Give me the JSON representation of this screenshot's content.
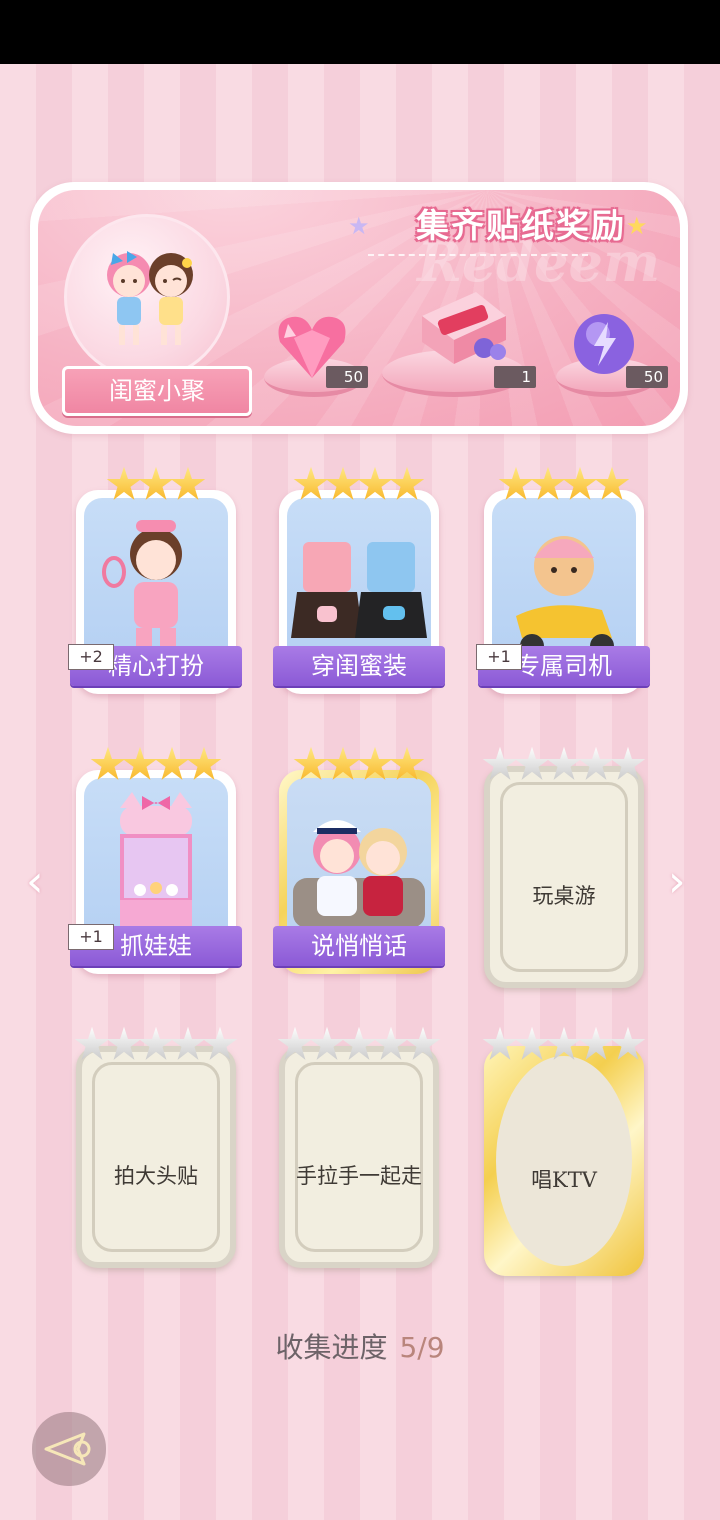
{
  "banner": {
    "title": "集齐贴纸奖励",
    "watermark": "Redeem",
    "friends_label": "闺蜜小聚",
    "rewards": [
      {
        "icon": "pink-heart-gem-icon",
        "count": "50"
      },
      {
        "icon": "gift-box-icon",
        "count": "1"
      },
      {
        "icon": "purple-lightning-orb-icon",
        "count": "50"
      }
    ]
  },
  "cards": [
    {
      "name": "精心打扮",
      "stars": 3,
      "tag": "+2",
      "unlocked": true
    },
    {
      "name": "穿闺蜜装",
      "stars": 4,
      "tag": "",
      "unlocked": true
    },
    {
      "name": "专属司机",
      "stars": 4,
      "tag": "+1",
      "unlocked": true
    },
    {
      "name": "抓娃娃",
      "stars": 4,
      "tag": "+1",
      "unlocked": true
    },
    {
      "name": "说悄悄话",
      "stars": 4,
      "tag": "",
      "unlocked": true
    },
    {
      "name": "玩桌游",
      "stars": 5,
      "unlocked": false
    },
    {
      "name": "拍大头贴",
      "stars": 5,
      "unlocked": false
    },
    {
      "name": "手拉手一起走",
      "stars": 5,
      "unlocked": false
    },
    {
      "name": "唱KTV",
      "stars": 5,
      "unlocked": false
    }
  ],
  "progress": {
    "label": "收集进度",
    "value": "5/9"
  },
  "nav": {
    "prev": "‹",
    "next": "›"
  }
}
